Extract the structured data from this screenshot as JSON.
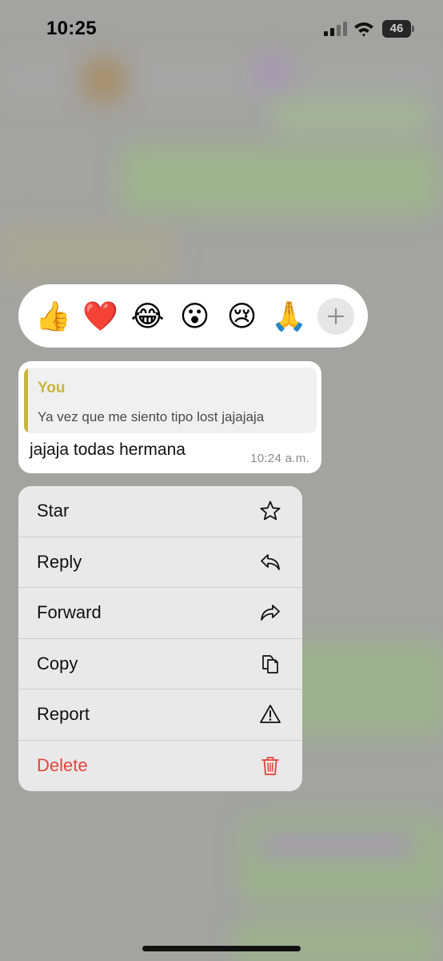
{
  "status_bar": {
    "time": "10:25",
    "battery_level": "46"
  },
  "reactions": [
    {
      "emoji": "👍",
      "name": "thumbs-up"
    },
    {
      "emoji": "❤️",
      "name": "red-heart"
    },
    {
      "emoji": "😂",
      "name": "tears-of-joy"
    },
    {
      "emoji": "😮",
      "name": "open-mouth"
    },
    {
      "emoji": "😢",
      "name": "crying-face"
    },
    {
      "emoji": "🙏",
      "name": "folded-hands"
    }
  ],
  "message": {
    "quote_author": "You",
    "quote_text": "Ya vez que me siento tipo lost jajajaja",
    "text": "jajaja todas hermana",
    "time": "10:24 a.m."
  },
  "menu": {
    "items": [
      {
        "label": "Star",
        "icon": "star-icon"
      },
      {
        "label": "Reply",
        "icon": "reply-icon"
      },
      {
        "label": "Forward",
        "icon": "forward-icon"
      },
      {
        "label": "Copy",
        "icon": "copy-icon"
      },
      {
        "label": "Report",
        "icon": "warning-icon"
      },
      {
        "label": "Delete",
        "icon": "trash-icon"
      }
    ]
  },
  "colors": {
    "quote_accent": "#c9b53c",
    "danger": "#e0463b",
    "menu_background": "#e9e9e9"
  }
}
